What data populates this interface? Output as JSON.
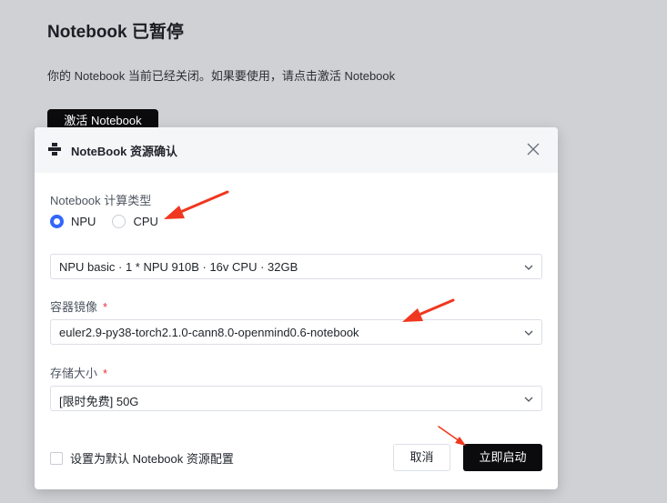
{
  "background": {
    "title": "Notebook 已暂停",
    "description": "你的 Notebook 当前已经关闭。如果要使用，请点击激活 Notebook",
    "activate_label": "激活 Notebook"
  },
  "modal": {
    "title": "NoteBook 资源确认",
    "header_icon": "notebook-icon",
    "close_icon": "close-icon",
    "compute_type": {
      "label": "Notebook 计算类型",
      "options": [
        {
          "label": "NPU",
          "checked": true
        },
        {
          "label": "CPU",
          "checked": false
        }
      ]
    },
    "spec": {
      "value": "NPU basic · 1 * NPU 910B · 16v CPU · 32GB"
    },
    "image": {
      "label": "容器镜像",
      "required_mark": "*",
      "value": "euler2.9-py38-torch2.1.0-cann8.0-openmind0.6-notebook"
    },
    "storage": {
      "label": "存储大小",
      "required_mark": "*",
      "value": "[限时免费] 50G"
    },
    "default_checkbox_label": "设置为默认 Notebook 资源配置",
    "cancel_label": "取消",
    "start_label": "立即启动"
  },
  "colors": {
    "accent": "#3366ff",
    "primary_button": "#0b0b0d",
    "required": "#e8313f",
    "annotation_arrow": "#f0371f",
    "overlay": "#d0d1d5"
  }
}
